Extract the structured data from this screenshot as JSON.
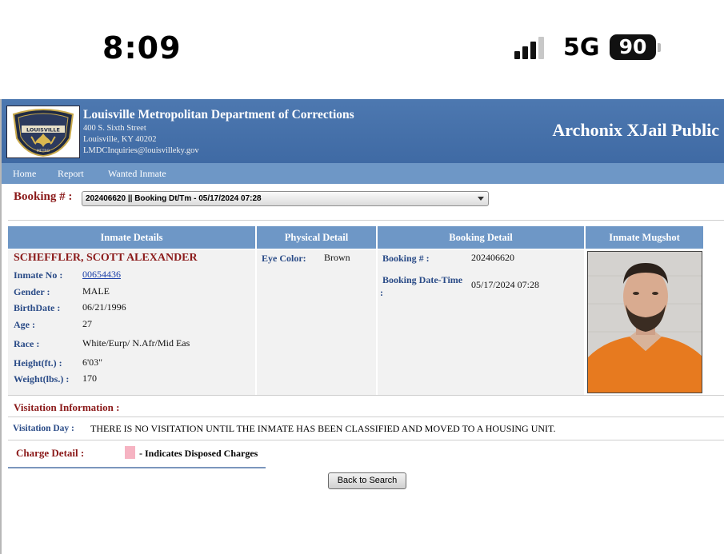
{
  "status_bar": {
    "time": "8:09",
    "network": "5G",
    "battery": "90"
  },
  "header": {
    "org_name": "Louisville Metropolitan Department of Corrections",
    "address_line1": "400 S. Sixth Street",
    "address_line2": "Louisville, KY 40202",
    "email": "LMDCInquiries@louisvilleky.gov",
    "app_title": "Archonix XJail Public",
    "logo_text": "LOUISVILLE METRO"
  },
  "nav": {
    "items": [
      "Home",
      "Report",
      "Wanted Inmate"
    ]
  },
  "booking_selector": {
    "label": "Booking # :",
    "selected": "202406620 || Booking Dt/Tm - 05/17/2024 07:28"
  },
  "panels": {
    "inmate_details": "Inmate Details",
    "physical_detail": "Physical Detail",
    "booking_detail": "Booking Detail",
    "inmate_mugshot": "Inmate Mugshot"
  },
  "inmate": {
    "name": "SCHEFFLER, SCOTT ALEXANDER",
    "fields": [
      {
        "label": "Inmate No :",
        "value": "00654436"
      },
      {
        "label": "Gender :",
        "value": "MALE"
      },
      {
        "label": "BirthDate :",
        "value": "06/21/1996"
      },
      {
        "label": "Age :",
        "value": "27"
      },
      {
        "label": "Race :",
        "value": "White/Eurp/ N.Afr/Mid Eas"
      },
      {
        "label": "Height(ft.) :",
        "value": "6'03\""
      },
      {
        "label": "Weight(lbs.) :",
        "value": "170"
      }
    ]
  },
  "physical": {
    "eye_color_label": "Eye Color:",
    "eye_color_value": "Brown"
  },
  "booking": {
    "number_label": "Booking # :",
    "number_value": "202406620",
    "datetime_label": "Booking Date-Time",
    "datetime_colon": ":",
    "datetime_value": "05/17/2024 07:28"
  },
  "visitation": {
    "section_label": "Visitation Information :",
    "day_label": "Visitation Day :",
    "day_text": "THERE IS NO VISITATION UNTIL THE INMATE HAS BEEN CLASSIFIED AND MOVED TO A HOUSING UNIT."
  },
  "charges": {
    "label": "Charge Detail :",
    "legend_text": "- Indicates Disposed Charges",
    "legend_color": "#f6b3c2"
  },
  "back_button": "Back to Search",
  "colors": {
    "header_blue": "#4d78b0",
    "nav_blue": "#6e97c6",
    "label_red": "#8b1a1a",
    "label_blue": "#2a4b87"
  }
}
